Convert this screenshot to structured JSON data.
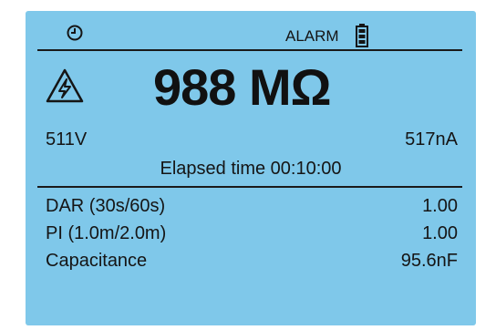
{
  "status": {
    "clock_icon": "clock-icon",
    "alarm_label": "ALARM",
    "battery_icon": "battery-icon"
  },
  "measurement": {
    "warning_icon": "high-voltage-warning-icon",
    "resistance": "988 MΩ",
    "voltage": "511V",
    "current": "517nA",
    "elapsed": "Elapsed time 00:10:00"
  },
  "results": [
    {
      "label": "DAR (30s/60s)",
      "value": "1.00"
    },
    {
      "label": "PI (1.0m/2.0m)",
      "value": "1.00"
    },
    {
      "label": "Capacitance",
      "value": "95.6nF"
    }
  ],
  "colors": {
    "screen_bg": "#7fc8ea",
    "text": "#151515"
  }
}
